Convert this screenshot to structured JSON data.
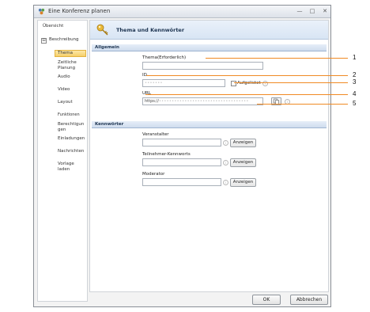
{
  "window": {
    "title": "Eine Konferenz planen",
    "min_glyph": "—",
    "max_glyph": "□",
    "close_glyph": "✕"
  },
  "sidebar": {
    "items": [
      {
        "label": "Übersicht"
      },
      {
        "label": "Beschreibung",
        "expander": "⊟"
      },
      {
        "label": "Thema",
        "active": true
      },
      {
        "label": "Zeitliche Planung"
      },
      {
        "label": "Audio"
      },
      {
        "label": "Video"
      },
      {
        "label": "Layout"
      },
      {
        "label": "Funktionen"
      },
      {
        "label": "Berechtigungen"
      },
      {
        "label": "Einladungen"
      },
      {
        "label": "Nachrichten"
      },
      {
        "label": "Vorlage laden"
      }
    ]
  },
  "header": {
    "title": "Thema und Kennwörter",
    "icon": "key-icon"
  },
  "general": {
    "section_title": "Allgemein",
    "topic_label": "Thema(Erforderlich)",
    "topic_value": "",
    "id_label": "ID",
    "id_value": "•••••••",
    "unlisted_label": "Aufgelistet",
    "url_label": "URL",
    "url_prefix": "https://",
    "url_value": "•••••••••••••••••••••••••••••••••••"
  },
  "passwords": {
    "section_title": "Kennwörter",
    "rows": [
      {
        "label": "Veranstalter",
        "value": "",
        "button": "Anzeigen"
      },
      {
        "label": "Teilnehmer-Kennworts",
        "value": "",
        "button": "Anzeigen"
      },
      {
        "label": "Moderator",
        "value": "",
        "button": "Anzeigen"
      }
    ]
  },
  "footer": {
    "ok_label": "OK",
    "cancel_label": "Abbrechen"
  },
  "callouts": [
    "1",
    "2",
    "3",
    "4",
    "5"
  ],
  "colors": {
    "callout": "#f08a24",
    "active_item": "#f6cf6a",
    "section": "#cfdcee"
  }
}
